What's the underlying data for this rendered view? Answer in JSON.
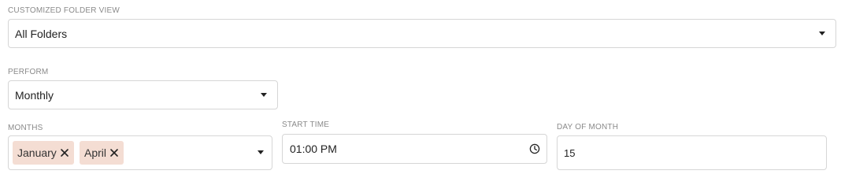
{
  "folder_view": {
    "label": "CUSTOMIZED FOLDER VIEW",
    "value": "All Folders",
    "icon": "chevron-down-icon"
  },
  "perform": {
    "label": "PERFORM",
    "value": "Monthly",
    "icon": "chevron-down-icon"
  },
  "months": {
    "label": "MONTHS",
    "selected": [
      {
        "label": "January",
        "remove_icon": "close-icon"
      },
      {
        "label": "April",
        "remove_icon": "close-icon"
      }
    ],
    "chip_color": "#f4ddd3",
    "icon": "chevron-down-icon"
  },
  "start_time": {
    "label": "START TIME",
    "value": "01:00 PM",
    "icon": "clock-icon"
  },
  "day_of_month": {
    "label": "DAY OF MONTH",
    "value": "15"
  }
}
